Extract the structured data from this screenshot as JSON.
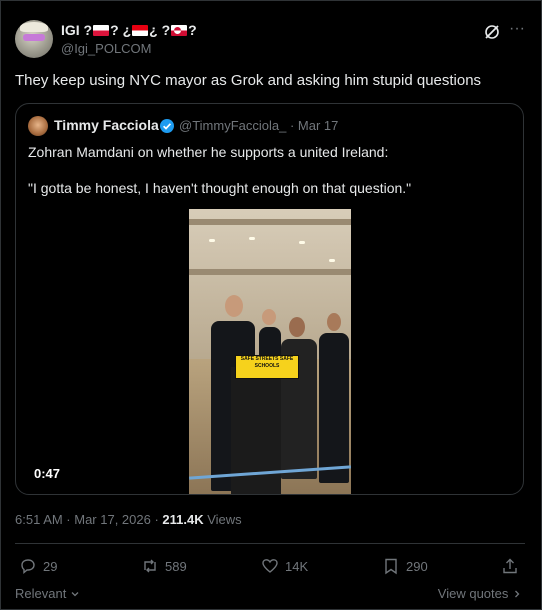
{
  "author": {
    "name_prefix": "IGI ?",
    "name_mid1": "? ¿",
    "name_mid2": "¿ ?",
    "name_end": "?",
    "handle": "@Igi_POLCOM"
  },
  "tweet": {
    "text": "They keep using NYC mayor as Grok and asking him stupid questions",
    "timestamp": "6:51 AM · Mar 17, 2026 · ",
    "views_count": "211.4K",
    "views_label": " Views"
  },
  "quoted": {
    "name": "Timmy Facciola",
    "handle_date": "@TimmyFacciola_ · Mar 17",
    "line1": "Zohran Mamdani on whether he supports a united Ireland:",
    "line2": "\"I gotta be honest, I haven't thought enough on that question.\"",
    "video_duration": "0:47",
    "sign_text": "SAFE STREETS SAFE SCHOOLS"
  },
  "actions": {
    "replies": "29",
    "reposts": "589",
    "likes": "14K",
    "bookmarks": "290"
  },
  "footer": {
    "relevant": "Relevant",
    "view_quotes": "View quotes"
  },
  "icons": [
    "grok-icon",
    "more-icon",
    "verified-icon",
    "reply-icon",
    "repost-icon",
    "like-icon",
    "bookmark-icon",
    "share-icon",
    "chevron-down-icon",
    "chevron-right-icon"
  ],
  "colors": {
    "background": "#000000",
    "text": "#e7e9ea",
    "muted": "#71767b",
    "border": "#2f3336",
    "verified": "#1d9bf0"
  }
}
